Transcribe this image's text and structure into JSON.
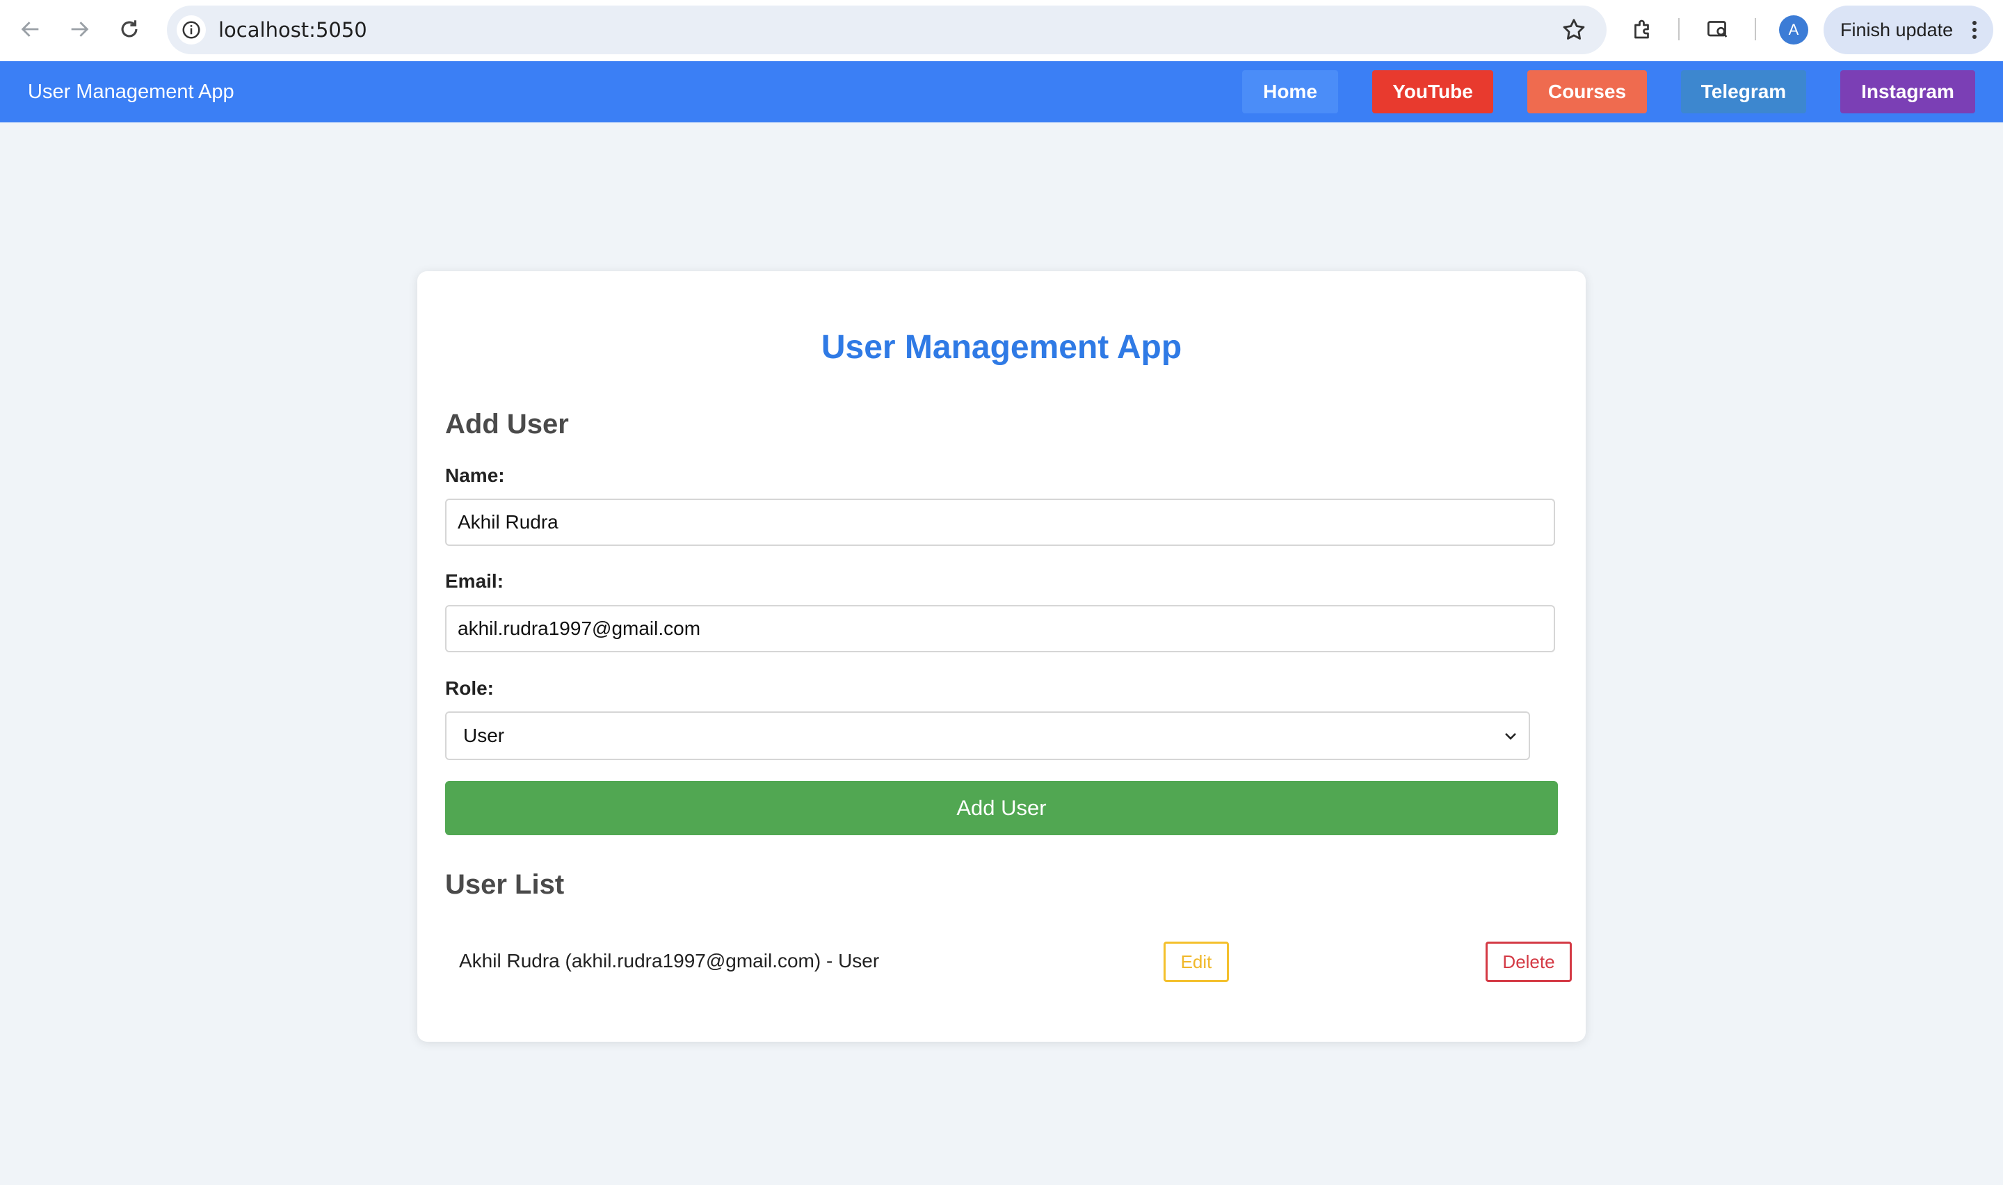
{
  "browser": {
    "url": "localhost:5050",
    "avatar_letter": "A",
    "update_label": "Finish update"
  },
  "navbar": {
    "brand": "User Management App",
    "links": [
      {
        "label": "Home",
        "color": "#4b8df8"
      },
      {
        "label": "YouTube",
        "color": "#e83a2e"
      },
      {
        "label": "Courses",
        "color": "#ef6b4f"
      },
      {
        "label": "Telegram",
        "color": "#3d87cf"
      },
      {
        "label": "Instagram",
        "color": "#7b3fb5"
      }
    ]
  },
  "card": {
    "title": "User Management App",
    "add_user_heading": "Add User",
    "form": {
      "name_label": "Name:",
      "name_value": "Akhil Rudra",
      "email_label": "Email:",
      "email_value": "akhil.rudra1997@gmail.com",
      "role_label": "Role:",
      "role_value": "User",
      "submit_label": "Add User"
    },
    "user_list_heading": "User List",
    "users": [
      {
        "summary": "Akhil Rudra (akhil.rudra1997@gmail.com) - User",
        "edit_label": "Edit",
        "delete_label": "Delete"
      }
    ]
  },
  "colors": {
    "navbar": "#3b7ff5",
    "title": "#2f7ae5",
    "add_button": "#51a752",
    "edit": "#f4c02c",
    "delete": "#d43a45",
    "page_bg": "#f0f4f8"
  }
}
